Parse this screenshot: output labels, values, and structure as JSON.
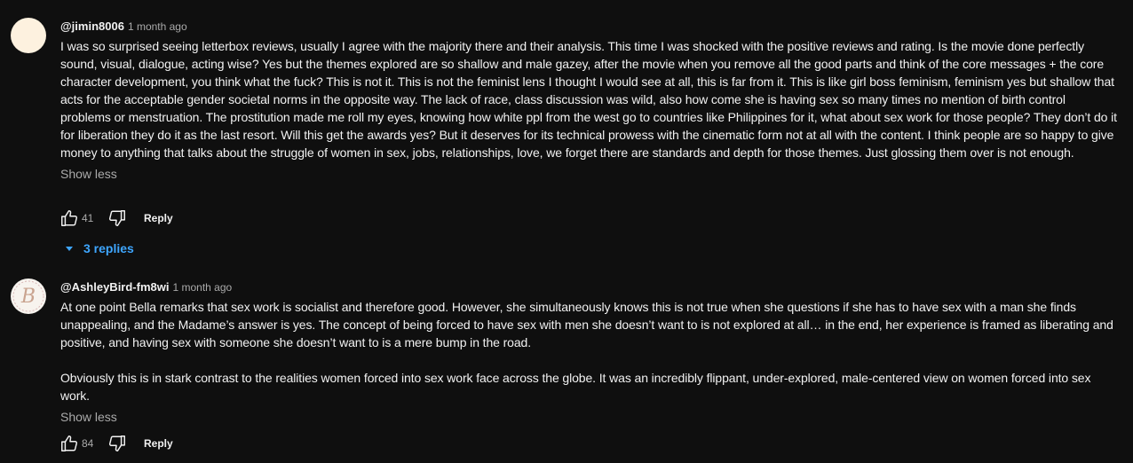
{
  "comments": [
    {
      "author": "@jimin8006",
      "time": "1 month ago",
      "paragraphs": [
        "I was so surprised seeing letterbox reviews, usually I agree with the majority there and their analysis. This time I was shocked with the positive reviews and rating. Is the movie done perfectly sound, visual, dialogue, acting wise? Yes but the themes explored are so shallow and male gazey, after the movie when you remove all the good parts and think of the core messages + the core character development, you think what the fuck? This is not it. This is not the feminist lens I thought I would see at all, this is far from it. This is like girl boss feminism, feminism yes but shallow that acts for the acceptable gender societal norms in the opposite way. The lack of race, class discussion was wild, also how come she is having sex so many times no mention of birth control problems or menstruation. The prostitution made me roll my eyes, knowing how white ppl from the west go to countries like Philippines for it, what about sex work for those people? They don’t do it for liberation they do it as the last resort. Will this get the awards yes? But it deserves for its technical prowess with the cinematic form not at all with the content. I think people are so happy to give money to anything that talks about the struggle of women in sex, jobs, relationships, love, we forget there are standards and depth for those themes. Just glossing them over is not enough."
      ],
      "show_less": "Show less",
      "likes": "41",
      "reply": "Reply",
      "replies_label": "3 replies"
    },
    {
      "author": "@AshleyBird-fm8wi",
      "time": "1 month ago",
      "avatar_letter": "B",
      "paragraphs": [
        "At one point Bella remarks that sex work is socialist and therefore good. However, she simultaneously knows this is not true when she questions if she has to have sex with a man she finds unappealing, and the Madame’s answer is yes. The concept of being forced to have sex with men she doesn’t want to is not explored at all… in the end, her experience is framed as liberating and positive, and having sex with someone she doesn’t want to is a mere bump in the road.",
        "Obviously this is in stark contrast to the realities women forced into sex work face across the globe. It was an incredibly flippant, under-explored, male-centered view on women forced into sex work."
      ],
      "show_less": "Show less",
      "likes": "84",
      "reply": "Reply"
    }
  ],
  "colors": {
    "background": "#0f0f0f",
    "text": "#f1f1f1",
    "secondary_text": "#aaaaaa",
    "link_blue": "#3ea6ff"
  },
  "icons": [
    "thumbs-up-icon",
    "thumbs-down-icon",
    "chevron-down-icon"
  ]
}
